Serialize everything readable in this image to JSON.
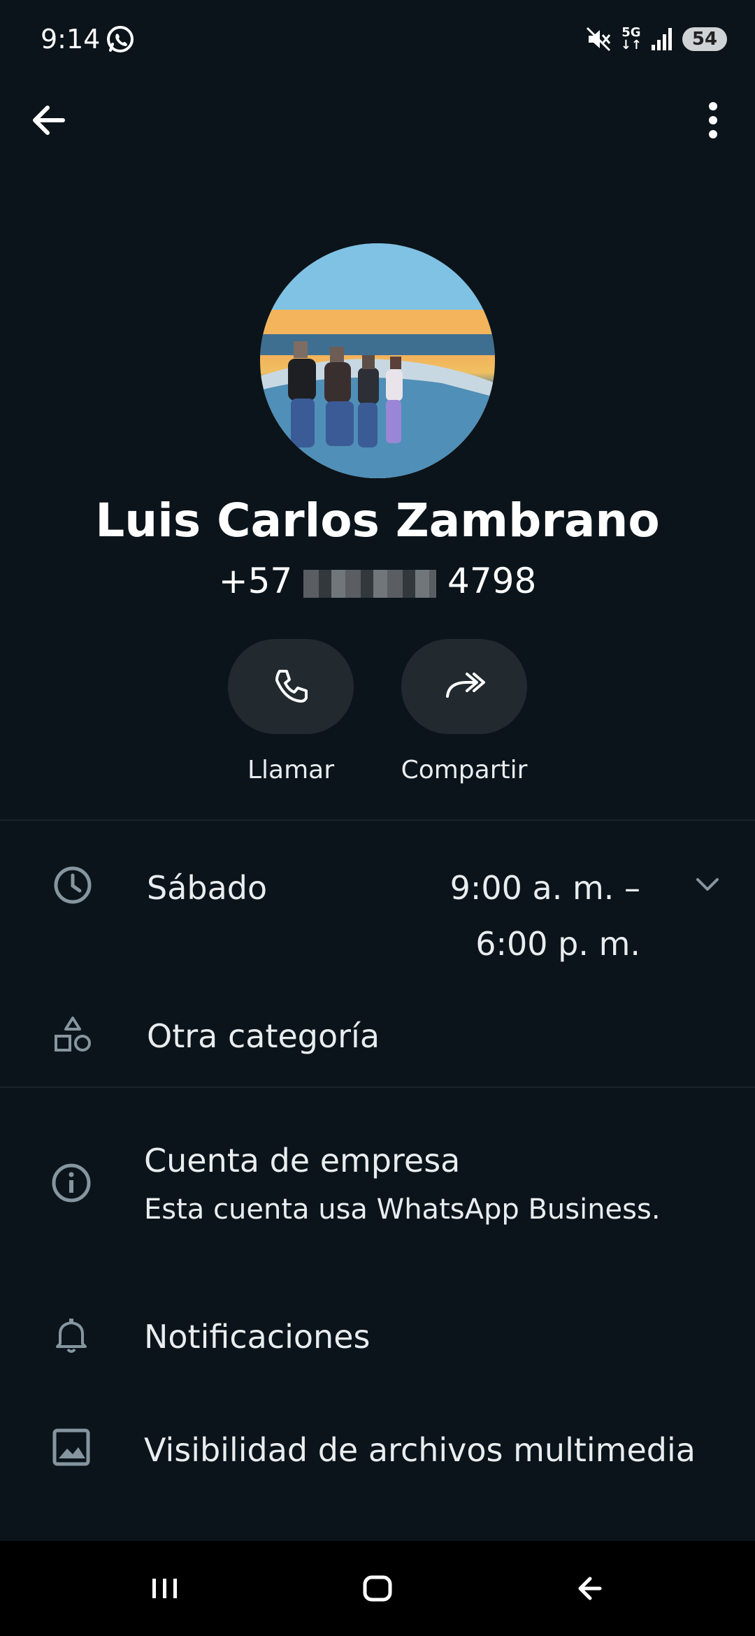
{
  "status_bar": {
    "time": "9:14",
    "network": "5G",
    "battery": "54"
  },
  "contact": {
    "name": "Luis Carlos Zambrano",
    "phone_prefix": "+57",
    "phone_suffix": "4798"
  },
  "actions": [
    {
      "label": "Llamar",
      "icon": "phone-icon"
    },
    {
      "label": "Compartir",
      "icon": "share-forward-icon"
    }
  ],
  "hours": {
    "day": "Sábado",
    "open": "9:00 a. m. –",
    "close": "6:00 p. m."
  },
  "category": "Otra categoría",
  "business": {
    "title": "Cuenta de empresa",
    "subtitle": "Esta cuenta usa WhatsApp Business."
  },
  "notifications_label": "Notificaciones",
  "media_visibility_label": "Visibilidad de archivos multimedia",
  "colors": {
    "background": "#0b141a",
    "button_bg": "#22292f",
    "text": "#e9edef",
    "icon": "#8696a0"
  }
}
